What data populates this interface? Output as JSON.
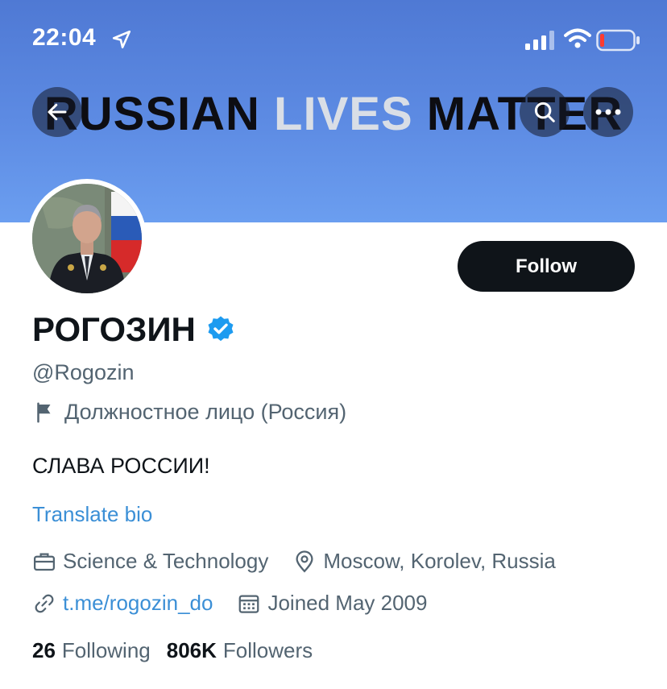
{
  "status_bar": {
    "time": "22:04"
  },
  "header": {
    "banner_words": {
      "w1": "RUSSIAN",
      "w2": "LIVES",
      "w3": "MATTER"
    }
  },
  "profile": {
    "follow_label": "Follow",
    "display_name": "РОГОЗИН",
    "handle": "@Rogozin",
    "account_label": "Должностное лицо (Россия)",
    "bio": "СЛАВА РОССИИ!",
    "translate_label": "Translate bio",
    "category": "Science & Technology",
    "location": "Moscow, Korolev, Russia",
    "website": "t.me/rogozin_do",
    "joined": "Joined May 2009",
    "following_count": "26",
    "following_label": "Following",
    "followers_count": "806K",
    "followers_label": "Followers"
  },
  "colors": {
    "banner": "#5d8be3",
    "link": "#3b8fd6",
    "verified": "#1d9bf0",
    "button": "#0f1419"
  }
}
